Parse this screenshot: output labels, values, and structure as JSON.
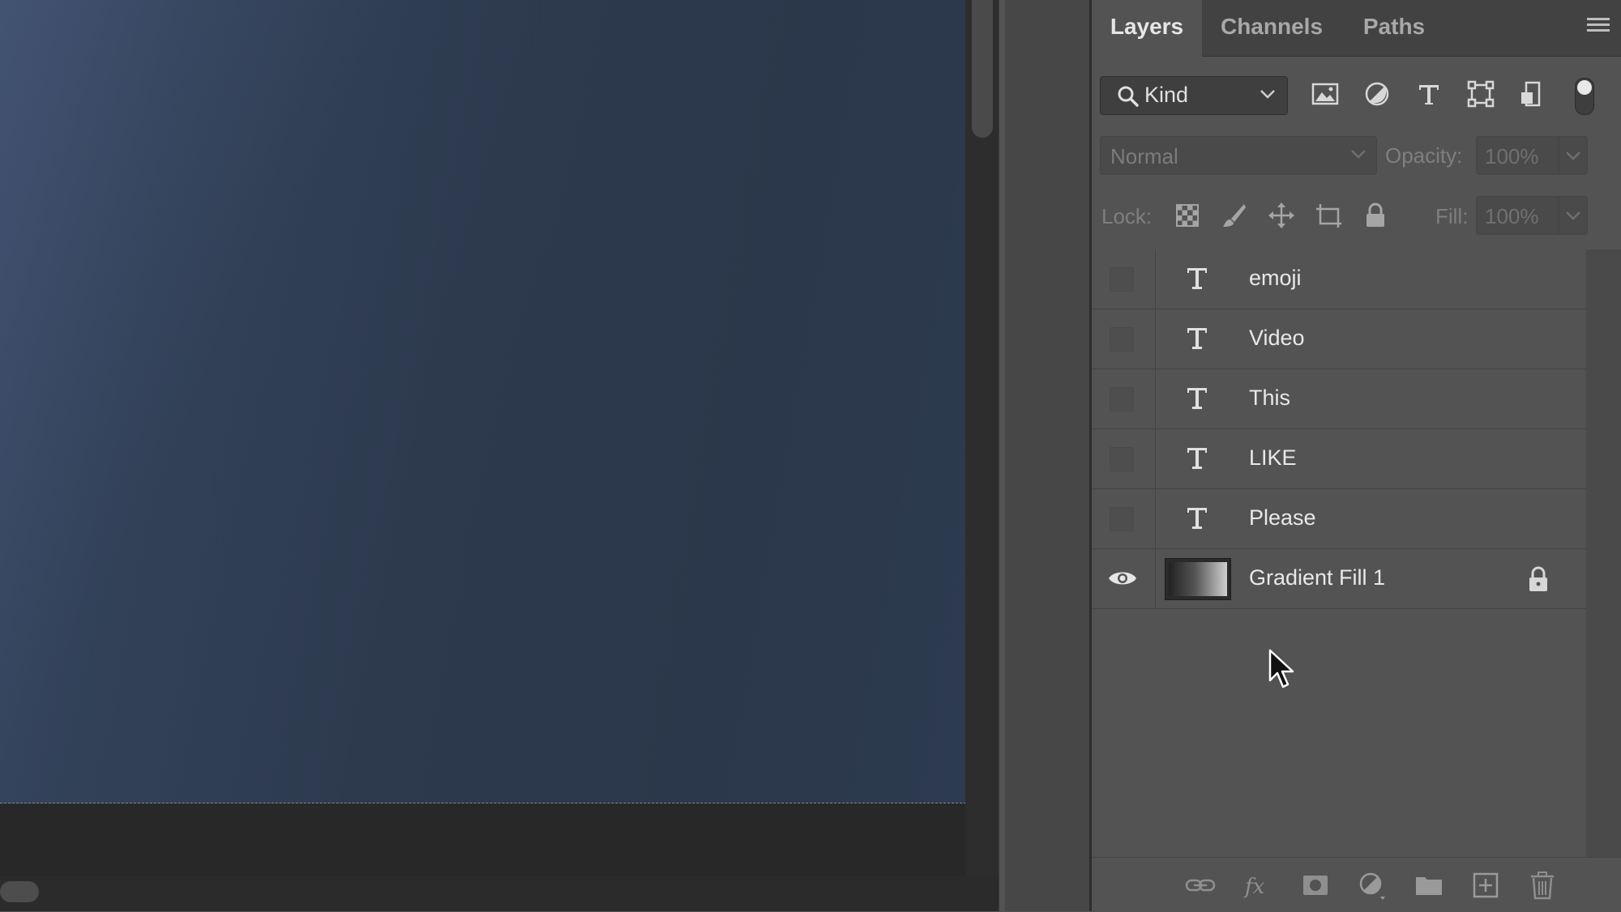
{
  "panel": {
    "tabs": [
      {
        "label": "Layers",
        "active": true
      },
      {
        "label": "Channels",
        "active": false
      },
      {
        "label": "Paths",
        "active": false
      }
    ]
  },
  "filter": {
    "kind_label": "Kind",
    "filter_icons": [
      "image-filter-icon",
      "adjustment-filter-icon",
      "type-filter-icon",
      "shape-filter-icon",
      "smart-object-filter-icon"
    ]
  },
  "blend": {
    "mode": "Normal",
    "opacity_label": "Opacity:",
    "opacity_value": "100%"
  },
  "lock": {
    "label": "Lock:",
    "fill_label": "Fill:",
    "fill_value": "100%",
    "icons": [
      "lock-transparent-pixels-icon",
      "lock-image-pixels-icon",
      "lock-position-icon",
      "lock-artboard-icon",
      "lock-all-icon"
    ]
  },
  "layers": [
    {
      "name": "emoji",
      "kind": "type",
      "visible": false
    },
    {
      "name": "Video",
      "kind": "type",
      "visible": false
    },
    {
      "name": "This",
      "kind": "type",
      "visible": false
    },
    {
      "name": "LIKE",
      "kind": "type",
      "visible": false
    },
    {
      "name": "Please",
      "kind": "type",
      "visible": false
    },
    {
      "name": "Gradient Fill 1",
      "kind": "gradient-fill",
      "visible": true,
      "locked": true
    }
  ],
  "bottom_bar": {
    "icons": [
      "link-layers-icon",
      "layer-style-fx-icon",
      "add-mask-icon",
      "new-adjustment-layer-icon",
      "new-group-folder-icon",
      "new-layer-icon",
      "delete-layer-icon"
    ]
  },
  "colors": {
    "panel_bg": "#535353",
    "document_bg": "#2d3a4e"
  }
}
